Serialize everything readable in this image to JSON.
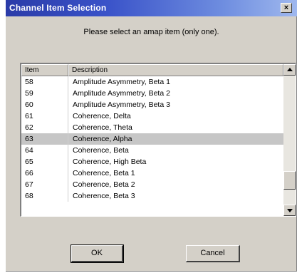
{
  "window": {
    "title": "Channel Item Selection",
    "close_glyph": "×"
  },
  "prompt": "Please select an amap item (only one).",
  "list": {
    "columns": [
      "Item",
      "Description"
    ],
    "rows": [
      {
        "item": "58",
        "description": "Amplitude Asymmetry, Beta 1"
      },
      {
        "item": "59",
        "description": "Amplitude Asymmetry, Beta 2"
      },
      {
        "item": "60",
        "description": "Amplitude Asymmetry, Beta 3"
      },
      {
        "item": "61",
        "description": "Coherence, Delta"
      },
      {
        "item": "62",
        "description": "Coherence, Theta"
      },
      {
        "item": "63",
        "description": "Coherence, Alpha"
      },
      {
        "item": "64",
        "description": "Coherence, Beta"
      },
      {
        "item": "65",
        "description": "Coherence, High Beta"
      },
      {
        "item": "66",
        "description": "Coherence, Beta 1"
      },
      {
        "item": "67",
        "description": "Coherence, Beta 2"
      },
      {
        "item": "68",
        "description": "Coherence, Beta 3"
      }
    ],
    "selected_item": "63"
  },
  "buttons": {
    "ok_label": "OK",
    "cancel_label": "Cancel"
  },
  "icons": {
    "scroll_up": "triangle-up-icon",
    "scroll_down": "triangle-down-icon",
    "close": "close-icon"
  }
}
